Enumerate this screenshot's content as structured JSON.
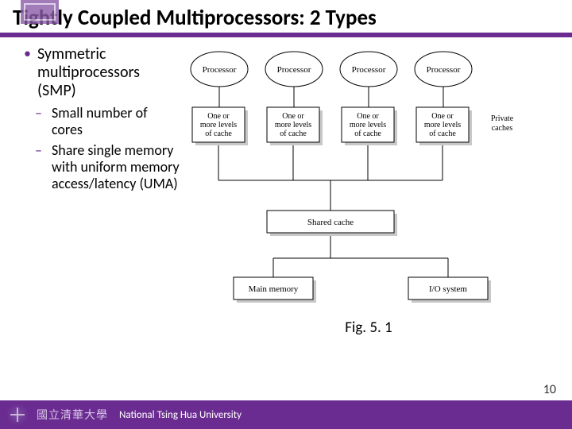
{
  "title": "Tightly Coupled Multiprocessors: 2 Types",
  "bullet1": "Symmetric multiprocessors (SMP)",
  "sub1": "Small number of cores",
  "sub2": "Share single memory with uniform memory access/latency (UMA)",
  "figcap": "Fig. 5. 1",
  "diagram": {
    "proc": "Processor",
    "cache1": "One or",
    "cache2": "more levels",
    "cache3": "of cache",
    "private": "Private",
    "private2": "caches",
    "shared": "Shared cache",
    "mem": "Main memory",
    "io": "I/O system"
  },
  "footer": {
    "chinese": "國立清華大學",
    "uni": "National Tsing Hua University"
  },
  "page": "10"
}
